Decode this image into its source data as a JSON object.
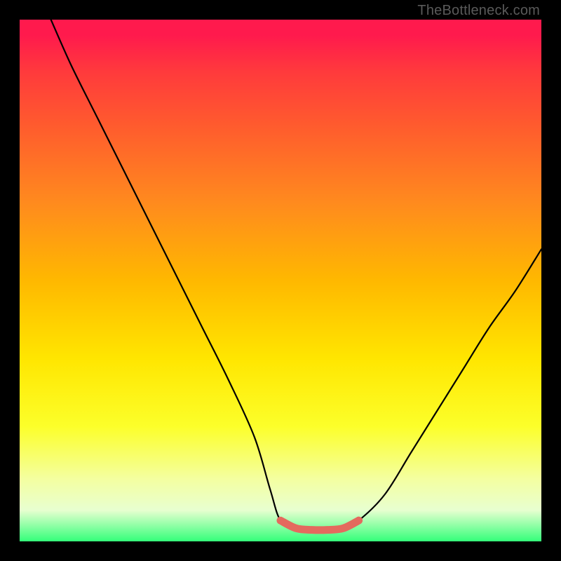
{
  "watermark": {
    "text": "TheBottleneck.com"
  },
  "colors": {
    "frame": "#000000",
    "curve": "#000000",
    "highlight": "#e46a5e",
    "gradient_stops": [
      "#ff1a4d",
      "#ff3a3c",
      "#ff5a2e",
      "#ff8a1e",
      "#ffb800",
      "#ffe600",
      "#fcff2a",
      "#f4ffa0",
      "#e8ffd0",
      "#34ff7a"
    ]
  },
  "chart_data": {
    "type": "line",
    "title": "",
    "xlabel": "",
    "ylabel": "",
    "xlim": [
      0,
      100
    ],
    "ylim": [
      0,
      100
    ],
    "grid": false,
    "series": [
      {
        "name": "bottleneck-curve",
        "x": [
          6,
          10,
          15,
          20,
          25,
          30,
          35,
          40,
          45,
          48,
          50,
          53,
          56,
          59,
          62,
          65,
          70,
          75,
          80,
          85,
          90,
          95,
          100
        ],
        "y": [
          100,
          91,
          81,
          71,
          61,
          51,
          41,
          31,
          20,
          10,
          4,
          2.5,
          2.2,
          2.2,
          2.5,
          4,
          9,
          17,
          25,
          33,
          41,
          48,
          56
        ]
      }
    ],
    "annotations": [
      {
        "name": "low-bottleneck-band",
        "x_range": [
          50,
          65
        ],
        "y": 2.3,
        "note": "thick highlighted segment near minimum"
      }
    ]
  }
}
